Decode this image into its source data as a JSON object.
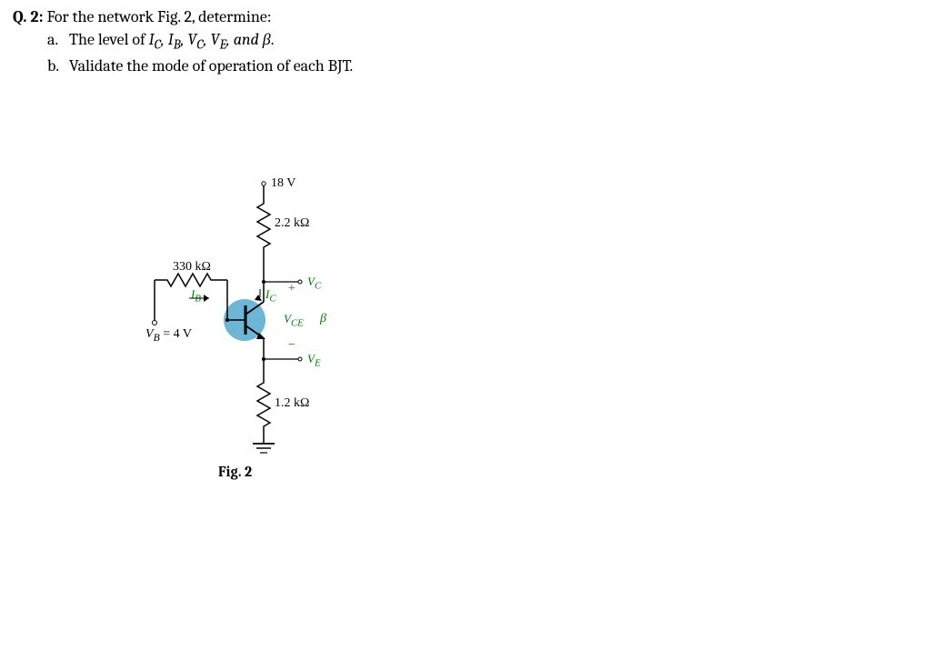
{
  "question": {
    "number": "Q. 2:",
    "prompt": " For the network Fig. 2, determine:",
    "items": {
      "a": {
        "letter": "a.",
        "text_prefix": "The level of ",
        "vars": "I_C, I_B, V_C, V_E, and β",
        "text_suffix": "."
      },
      "b": {
        "letter": "b.",
        "text": "Validate the mode of operation of each BJT."
      }
    }
  },
  "circuit": {
    "supply": "18 V",
    "rc": "2.2 kΩ",
    "rb": "330 kΩ",
    "re": "1.2 kΩ",
    "vb": "V_B = 4 V",
    "ib": "I_B",
    "ic": "I_C",
    "vc": "V_C",
    "vce": "V_CE",
    "ve": "V_E",
    "beta": "β",
    "plus": "+",
    "minus": "−"
  },
  "figure_caption": "Fig. 2"
}
